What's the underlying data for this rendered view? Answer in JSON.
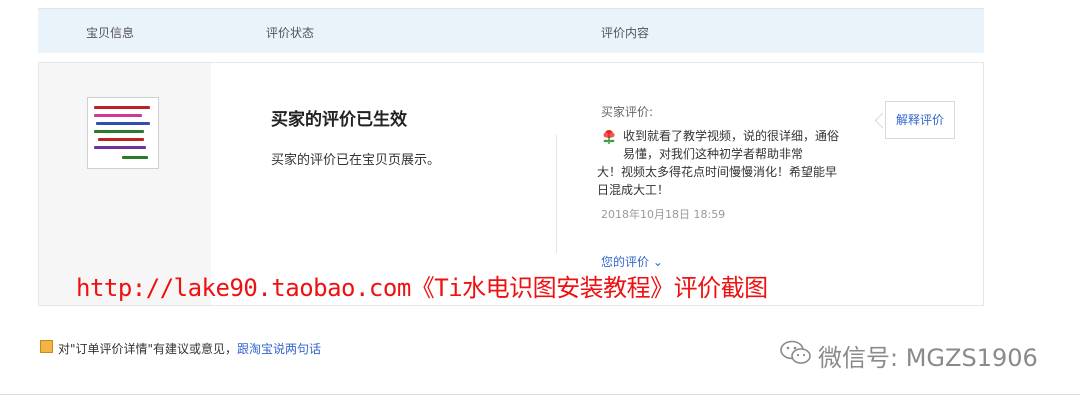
{
  "header": {
    "col_item": "宝贝信息",
    "col_status": "评价状态",
    "col_content": "评价内容"
  },
  "card": {
    "status_title": "买家的评价已生效",
    "status_desc": "买家的评价已在宝贝页展示。",
    "review_label": "买家评价:",
    "review_text_first": "收到就看了教学视频，说的很详细，通俗易懂，对我们这种初学者帮助非常",
    "review_text_rest": "大！视频太多得花点时间慢慢消化！希望能早日混成大工！",
    "review_time": "2018年10月18日 18:59",
    "your_review_label": "您的评价 ⌄",
    "explain_button": "解释评价"
  },
  "overlay": {
    "url_text": "http://lake90.taobao.com《Ti水电识图安装教程》评价截图"
  },
  "footer": {
    "prefix": "对\"订单评价详情\"有建议或意见，",
    "link": "跟淘宝说两句话"
  },
  "watermark": {
    "text": "微信号: MGZS1906"
  },
  "colors": {
    "header_bg": "#eaf2fa",
    "link": "#3366cc",
    "overlay_red": "#ee1111"
  }
}
